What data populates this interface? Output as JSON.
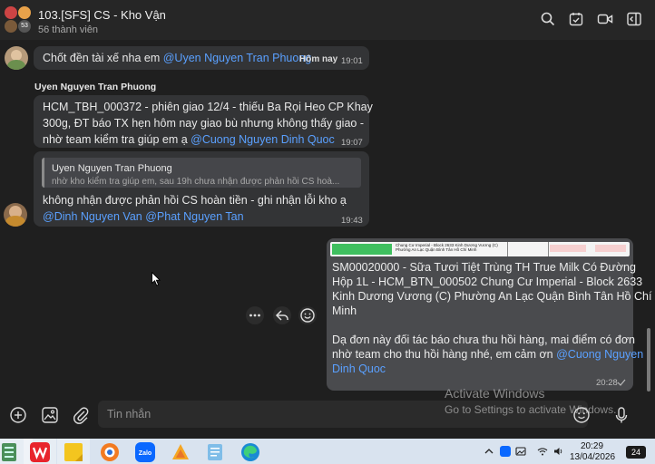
{
  "header": {
    "title": "103.[SFS] CS - Kho Vận",
    "members": "56 thành viên",
    "avatar_badge": "53"
  },
  "messages": {
    "m1": {
      "text": "Chốt đền tài xế nha em ",
      "mention": "@Uyen Nguyen Tran Phuong",
      "tag": "Hôm nay",
      "time": "19:01"
    },
    "m2": {
      "sender": "Uyen Nguyen Tran Phuong",
      "line1": "HCM_TBH_000372 - phiên giao 12/4 - thiếu Ba Rọi Heo CP Khay",
      "line2": "300g, ĐT báo TX hẹn hôm nay giao bù nhưng không thấy giao -",
      "line3": "nhờ team kiểm tra giúp em ạ ",
      "mention": "@Cuong Nguyen Dinh Quoc",
      "time": "19:07"
    },
    "m3": {
      "quote_author": "Uyen Nguyen Tran Phuong",
      "quote_text": "nhờ kho kiểm tra giúp em, sau 19h chưa nhận được phản hồi CS hoà...",
      "line1": "không nhận được phản hồi CS hoàn tiền - ghi nhận lỗi kho ạ",
      "mention1": "@Dinh Nguyen Van",
      "mention2": " @Phat Nguyen Tan",
      "time": "19:43"
    },
    "own": {
      "line1": "SM00020000   - Sữa Tươi Tiệt Trùng TH True Milk Có Đường",
      "line2": "Hộp 1L -  HCM_BTN_000502  Chung Cư Imperial - Block 2633",
      "line3": "Kinh Dương Vương (C) Phường An Lạc Quận Bình Tân Hồ Chí",
      "line4": "Minh",
      "line5": "Dạ đơn này đối tác báo chưa thu hồi hàng, mai điểm có đơn",
      "line6": "nhờ team cho thu hồi hàng nhé, em cảm ơn ",
      "mention_a": "@Cuong Nguyen",
      "mention_b": "Dinh Quoc",
      "time": "20:28",
      "attachment_text": "Chung Cư Imperial - Block 2633 Kinh Dương Vương (C) Phường An Lạc Quận Bình Tân Hồ Chí Minh"
    }
  },
  "composer": {
    "placeholder": "Tin nhắn"
  },
  "watermark": {
    "title": "Activate Windows",
    "subtitle": "Go to Settings to activate Windows."
  },
  "taskbar": {
    "time": "20:29",
    "date": "13/04/2026",
    "notifications": "24"
  },
  "colors": {
    "mention": "#5aa0ff",
    "bubble": "#333436",
    "own_bubble": "#4a4b4e",
    "background": "#1f1f1f"
  }
}
